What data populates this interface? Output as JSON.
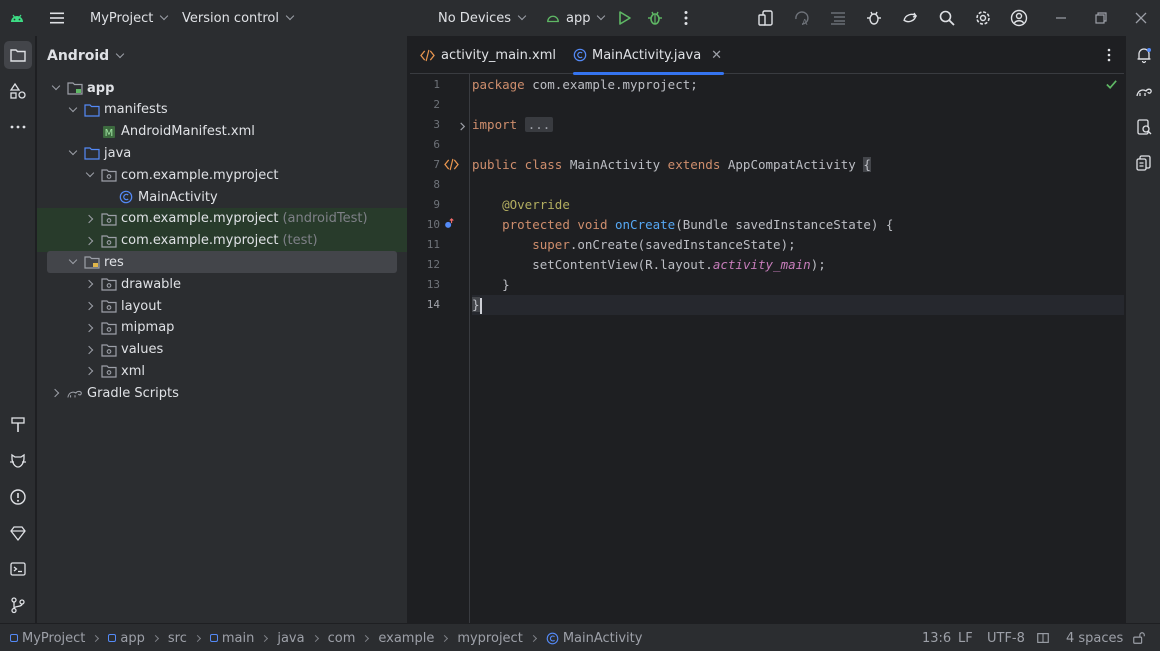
{
  "titlebar": {
    "project": "MyProject",
    "vcs": "Version control",
    "devices": "No Devices",
    "run_config": "app"
  },
  "project_panel": {
    "view": "Android",
    "tree": [
      {
        "label": "app",
        "suffix": "",
        "depth": 0,
        "arrow": "down",
        "icon": "module-folder-icon",
        "state": ""
      },
      {
        "label": "manifests",
        "suffix": "",
        "depth": 1,
        "arrow": "down",
        "icon": "folder-icon",
        "state": ""
      },
      {
        "label": "AndroidManifest.xml",
        "suffix": "",
        "depth": 2,
        "arrow": "none",
        "icon": "manifest-file-icon",
        "state": ""
      },
      {
        "label": "java",
        "suffix": "",
        "depth": 1,
        "arrow": "down",
        "icon": "folder-icon",
        "state": ""
      },
      {
        "label": "com.example.myproject",
        "suffix": "",
        "depth": 2,
        "arrow": "down",
        "icon": "package-icon",
        "state": ""
      },
      {
        "label": "MainActivity",
        "suffix": "",
        "depth": 3,
        "arrow": "none",
        "icon": "class-icon",
        "state": ""
      },
      {
        "label": "com.example.myproject",
        "suffix": "(androidTest)",
        "depth": 2,
        "arrow": "right",
        "icon": "package-icon",
        "state": "green"
      },
      {
        "label": "com.example.myproject",
        "suffix": "(test)",
        "depth": 2,
        "arrow": "right",
        "icon": "package-icon",
        "state": "green"
      },
      {
        "label": "res",
        "suffix": "",
        "depth": 1,
        "arrow": "down",
        "icon": "resource-folder-icon",
        "state": "selected"
      },
      {
        "label": "drawable",
        "suffix": "",
        "depth": 2,
        "arrow": "right",
        "icon": "package-icon",
        "state": ""
      },
      {
        "label": "layout",
        "suffix": "",
        "depth": 2,
        "arrow": "right",
        "icon": "package-icon",
        "state": ""
      },
      {
        "label": "mipmap",
        "suffix": "",
        "depth": 2,
        "arrow": "right",
        "icon": "package-icon",
        "state": ""
      },
      {
        "label": "values",
        "suffix": "",
        "depth": 2,
        "arrow": "right",
        "icon": "package-icon",
        "state": ""
      },
      {
        "label": "xml",
        "suffix": "",
        "depth": 2,
        "arrow": "right",
        "icon": "package-icon",
        "state": ""
      },
      {
        "label": "Gradle Scripts",
        "suffix": "",
        "depth": 0,
        "arrow": "right",
        "icon": "gradle-icon",
        "state": ""
      }
    ]
  },
  "editor": {
    "tabs": [
      {
        "label": "activity_main.xml",
        "icon": "xml-file-icon",
        "active": false
      },
      {
        "label": "MainActivity.java",
        "icon": "class-icon",
        "active": true
      }
    ],
    "line_numbers": [
      "1",
      "2",
      "3",
      "6",
      "7",
      "8",
      "9",
      "10",
      "11",
      "12",
      "13",
      "14"
    ],
    "code": {
      "l1_kw": "package",
      "l1_rest": " com.example.myproject;",
      "l3_kw": "import",
      "l3_fold": "...",
      "l7_kw1": "public class",
      "l7_name": " MainActivity ",
      "l7_kw2": "extends",
      "l7_super": " AppCompatActivity ",
      "l7_brace": "{",
      "l9_ann": "@Override",
      "l10_kw": "protected void",
      "l10_fn": "onCreate",
      "l10_rest": "(Bundle savedInstanceState) {",
      "l11_kw": "super",
      "l11_rest": ".onCreate(savedInstanceState);",
      "l12_pre": "setContentView(R.layout.",
      "l12_it": "activity_main",
      "l12_post": ");",
      "l13": "}",
      "l14": "}"
    }
  },
  "statusbar": {
    "breadcrumbs": [
      "MyProject",
      "app",
      "src",
      "main",
      "java",
      "com",
      "example",
      "myproject",
      "MainActivity"
    ],
    "position": "13:6",
    "line_ending": "LF",
    "encoding": "UTF-8",
    "indent": "4 spaces"
  },
  "colors": {
    "accent": "#3574f0",
    "run_green": "#5fb865",
    "keyword": "#cf8e6d",
    "function": "#56a8f5",
    "annotation": "#b3ae60"
  }
}
